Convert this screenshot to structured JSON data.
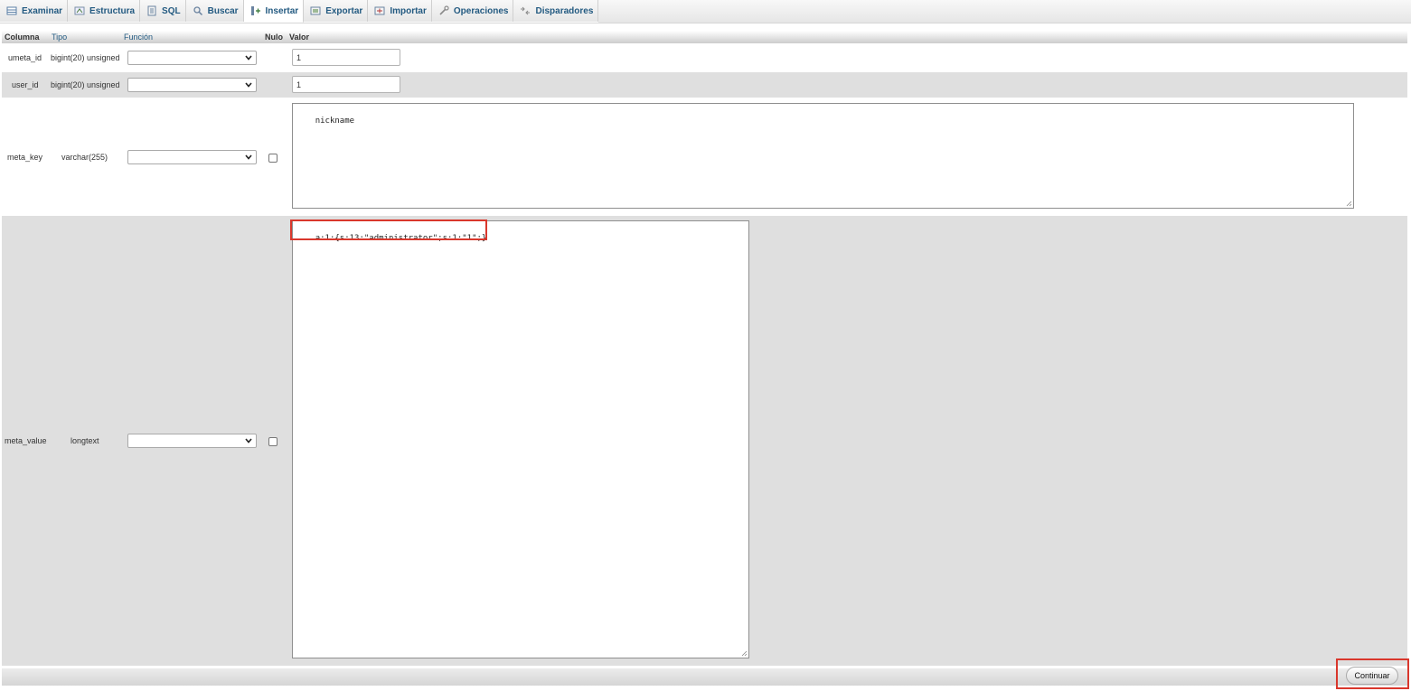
{
  "tabs": [
    {
      "label": "Examinar",
      "icon": "browse-icon"
    },
    {
      "label": "Estructura",
      "icon": "structure-icon"
    },
    {
      "label": "SQL",
      "icon": "sql-icon"
    },
    {
      "label": "Buscar",
      "icon": "search-icon"
    },
    {
      "label": "Insertar",
      "icon": "insert-icon",
      "active": true
    },
    {
      "label": "Exportar",
      "icon": "export-icon"
    },
    {
      "label": "Importar",
      "icon": "import-icon"
    },
    {
      "label": "Operaciones",
      "icon": "operations-icon"
    },
    {
      "label": "Disparadores",
      "icon": "triggers-icon"
    }
  ],
  "table_header": {
    "column": "Columna",
    "type": "Tipo",
    "function": "Función",
    "null": "Nulo",
    "value": "Valor"
  },
  "rows": [
    {
      "column": "umeta_id",
      "type": "bigint(20) unsigned",
      "function": "",
      "value": "1"
    },
    {
      "column": "user_id",
      "type": "bigint(20) unsigned",
      "function": "",
      "value": "1"
    },
    {
      "column": "meta_key",
      "type": "varchar(255)",
      "function": "",
      "value": "nickname"
    },
    {
      "column": "meta_value",
      "type": "longtext",
      "function": "",
      "value": "a:1:{s:13:\"administrator\";s:1:\"1\";}"
    }
  ],
  "submit": {
    "label": "Continuar"
  },
  "colors": {
    "link": "#235a81",
    "highlight": "#d9372c",
    "row_dark": "#dfdfdf"
  }
}
